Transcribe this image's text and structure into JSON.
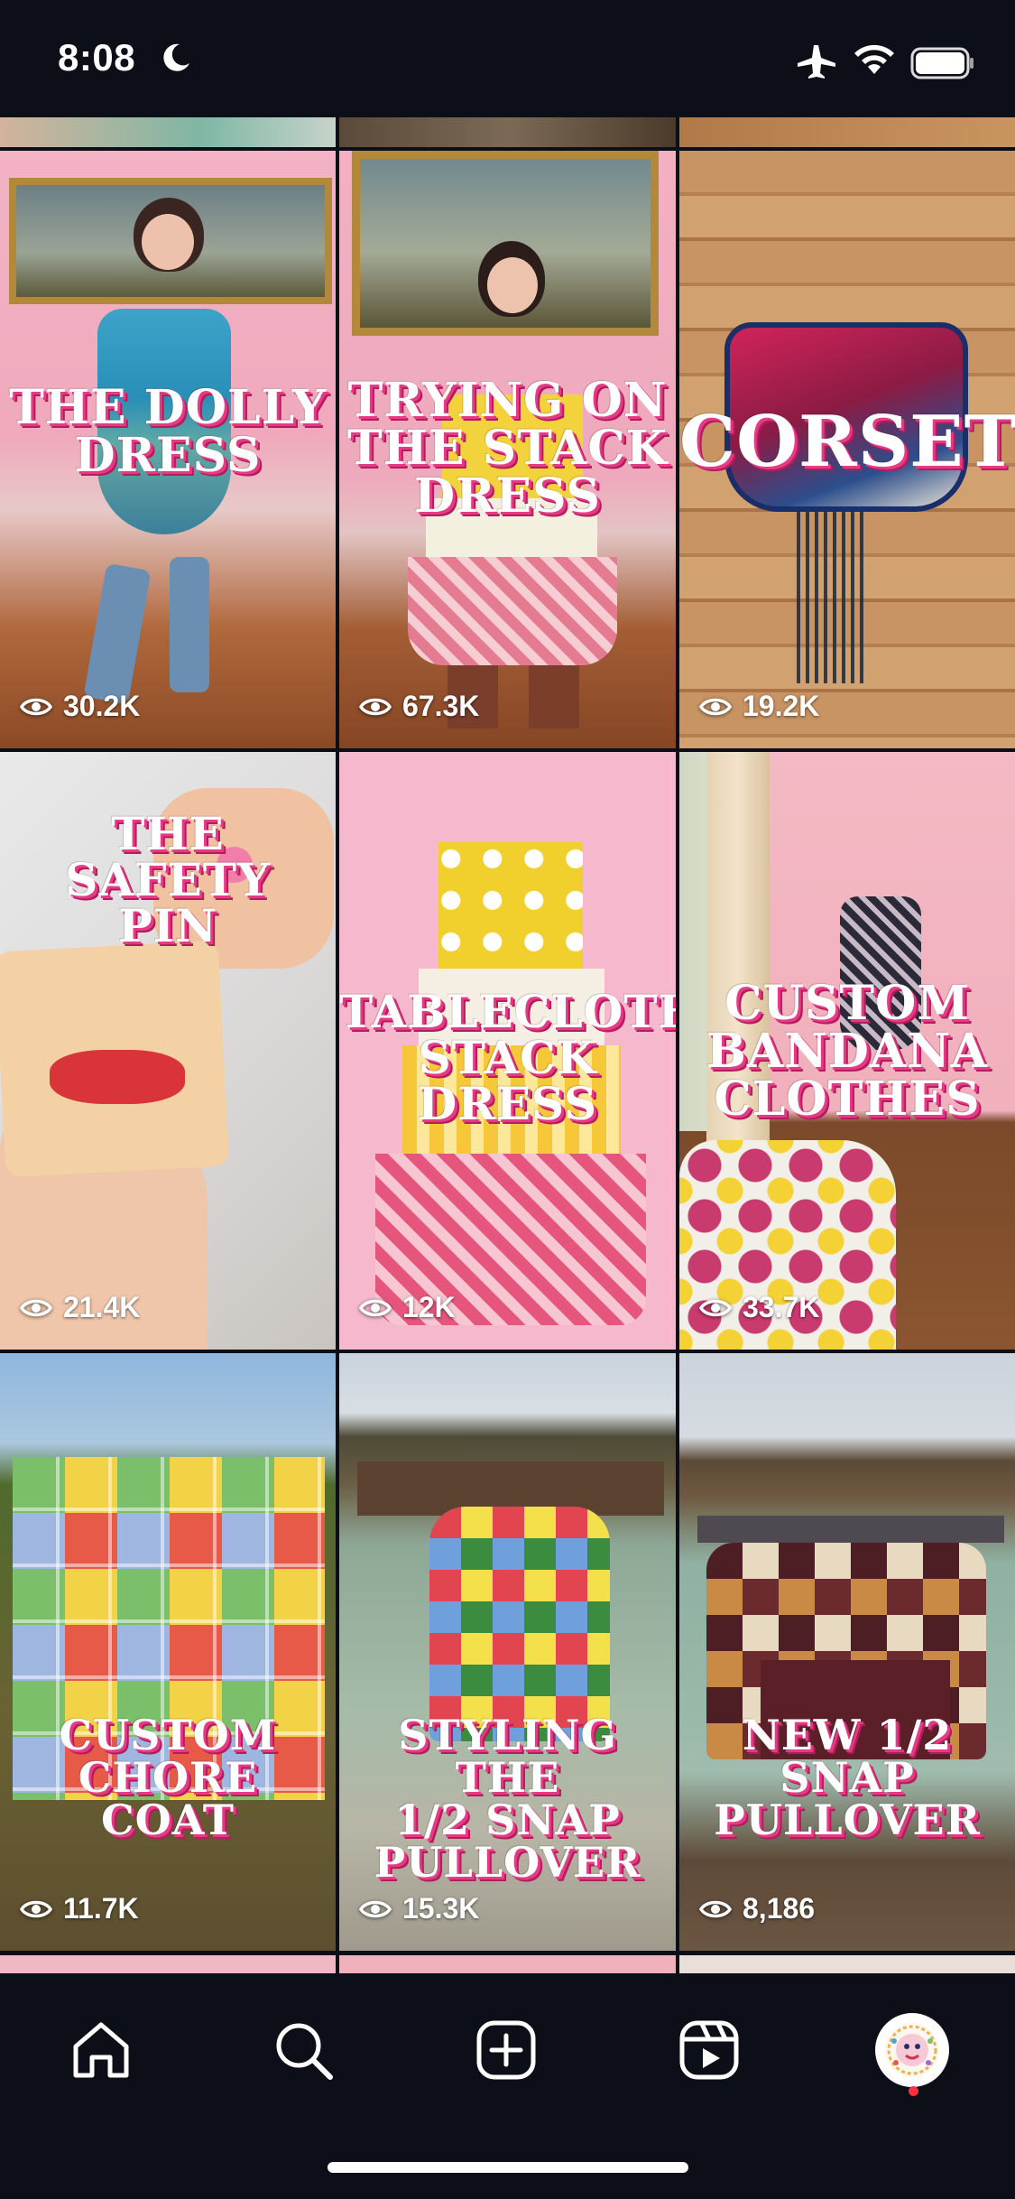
{
  "status_bar": {
    "time": "8:08"
  },
  "reels": [
    {
      "title": "THE DOLLY\nDRESS",
      "views": "30.2K"
    },
    {
      "title": "TRYING ON\nTHE STACK\nDRESS",
      "views": "67.3K"
    },
    {
      "title": "CORSETS",
      "views": "19.2K"
    },
    {
      "title": "THE\nSAFETY\nPIN",
      "views": "21.4K"
    },
    {
      "title": "TABLECLOTH\nSTACK DRESS",
      "views": "12K"
    },
    {
      "title": "CUSTOM\nBANDANA\nCLOTHES",
      "views": "33.7K"
    },
    {
      "title": "CUSTOM CHORE\nCOAT",
      "views": "11.7K"
    },
    {
      "title": "STYLING THE\n1/2 SNAP\nPULLOVER",
      "views": "15.3K"
    },
    {
      "title": "NEW 1/2 SNAP\nPULLOVER",
      "views": "8,186"
    }
  ],
  "icons": {
    "status": [
      "moon-icon",
      "airplane-icon",
      "wifi-icon",
      "battery-icon"
    ],
    "views": "eye-icon",
    "nav": [
      "home-icon",
      "search-icon",
      "create-icon",
      "reels-icon",
      "profile-avatar"
    ]
  },
  "colors": {
    "background": "#0c0f17",
    "title_shadow": "#e63a86",
    "notification": "#ff3040"
  }
}
